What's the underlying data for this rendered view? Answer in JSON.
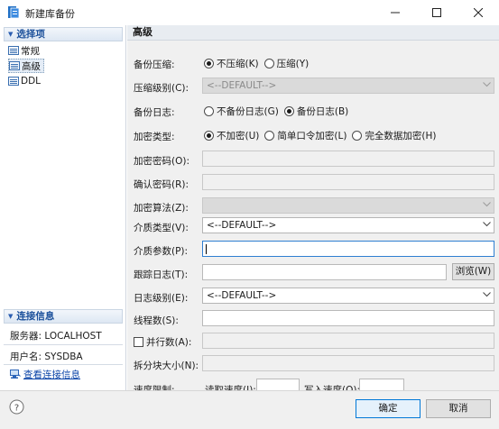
{
  "window": {
    "title": "新建库备份"
  },
  "left": {
    "options_header": "选择项",
    "nav_items": [
      {
        "label": "常规"
      },
      {
        "label": "高级"
      },
      {
        "label": "DDL"
      }
    ],
    "connection_header": "连接信息",
    "server_line": "服务器: LOCALHOST",
    "user_line": "用户名: SYSDBA",
    "view_connection_link": "查看连接信息"
  },
  "right": {
    "title": "高级",
    "compression": {
      "label": "备份压缩:",
      "options": [
        "不压缩(K)",
        "压缩(Y)"
      ],
      "selected": "不压缩(K)"
    },
    "compression_level": {
      "label": "压缩级别(C):",
      "value": "<--DEFAULT-->"
    },
    "backup_log": {
      "label": "备份日志:",
      "options": [
        "不备份日志(G)",
        "备份日志(B)"
      ],
      "selected": "备份日志(B)"
    },
    "encryption_type": {
      "label": "加密类型:",
      "options": [
        "不加密(U)",
        "简单口令加密(L)",
        "完全数据加密(H)"
      ],
      "selected": "不加密(U)"
    },
    "encrypt_password": {
      "label": "加密密码(O):"
    },
    "confirm_password": {
      "label": "确认密码(R):"
    },
    "encrypt_algorithm": {
      "label": "加密算法(Z):"
    },
    "media_type": {
      "label": "介质类型(V):",
      "value": "<--DEFAULT-->"
    },
    "media_params": {
      "label": "介质参数(P):"
    },
    "trace_log": {
      "label": "跟踪日志(T):",
      "browse": "浏览(W)"
    },
    "log_level": {
      "label": "日志级别(E):",
      "value": "<--DEFAULT-->"
    },
    "thread_count": {
      "label": "线程数(S):"
    },
    "parallel_count": {
      "label": "并行数(A):"
    },
    "split_block_size": {
      "label": "拆分块大小(N):"
    },
    "speed_limit": {
      "label": "速度限制:",
      "read_label": "读取速度(I):",
      "write_label": "写入速度(Q):"
    }
  },
  "footer": {
    "ok": "确定",
    "cancel": "取消"
  }
}
